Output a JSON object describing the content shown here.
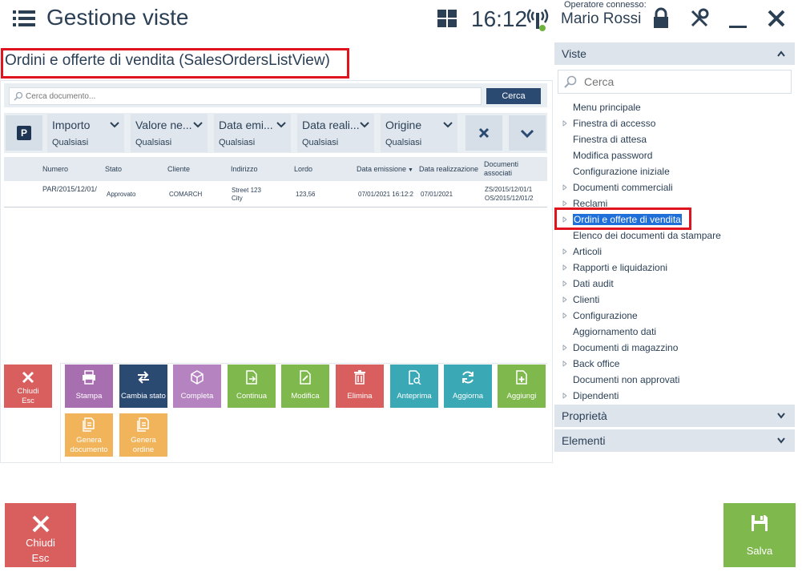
{
  "header": {
    "title": "Gestione viste",
    "clock": "16:12",
    "operator_label": "Operatore connesso:",
    "operator_name": "Mario Rossi"
  },
  "view": {
    "title": "Ordini e offerte di vendita (SalesOrdersListView)"
  },
  "search": {
    "placeholder": "Cerca documento...",
    "button_label": "Cerca"
  },
  "filters": [
    {
      "label": "Importo",
      "value": "Qualsiasi"
    },
    {
      "label": "Valore ne...",
      "value": "Qualsiasi"
    },
    {
      "label": "Data emi...",
      "value": "Qualsiasi"
    },
    {
      "label": "Data reali...",
      "value": "Qualsiasi"
    },
    {
      "label": "Origine",
      "value": "Qualsiasi"
    }
  ],
  "table": {
    "columns": [
      "Numero",
      "Stato",
      "Cliente",
      "Indirizzo",
      "Lordo",
      "Data emissione",
      "Data realizzazione",
      "Documenti associati"
    ],
    "rows": [
      {
        "numero": "PAR/2015/12/01/",
        "stato": "Approvato",
        "cliente": "COMARCH",
        "indirizzo_1": "Street 123",
        "indirizzo_2": "City",
        "lordo": "123,56",
        "data_emissione": "07/01/2021 16:12:2",
        "data_realizzazione": "07/01/2021",
        "doc_1": "ZS/2015/12/01/1",
        "doc_2": "OS/2015/12/01/2"
      }
    ]
  },
  "actions": {
    "close_small_1": "Chiudi",
    "close_small_2": "Esc",
    "tiles": [
      {
        "label": "Stampa",
        "color": "#a86fb0"
      },
      {
        "label": "Cambia stato",
        "color": "#2b4a72"
      },
      {
        "label": "Completa",
        "color": "#b584c0"
      },
      {
        "label": "Continua",
        "color": "#7fb84d"
      },
      {
        "label": "Modifica",
        "color": "#7fb84d"
      },
      {
        "label": "Elimina",
        "color": "#d95f5f"
      },
      {
        "label": "Anteprima",
        "color": "#3aa9b5"
      },
      {
        "label": "Aggiorna",
        "color": "#3aa9b5"
      },
      {
        "label": "Aggiungi",
        "color": "#7fb84d"
      }
    ],
    "tiles_row2": [
      {
        "label_1": "Genera",
        "label_2": "documento",
        "color": "#f2b45a"
      },
      {
        "label_1": "Genera",
        "label_2": "ordine",
        "color": "#f2b45a"
      }
    ]
  },
  "right_panel": {
    "viste_label": "Viste",
    "search_placeholder": "Cerca",
    "tree": [
      {
        "label": "Menu principale",
        "expandable": false
      },
      {
        "label": "Finestra di accesso",
        "expandable": true
      },
      {
        "label": "Finestra di attesa",
        "expandable": false
      },
      {
        "label": "Modifica password",
        "expandable": false
      },
      {
        "label": "Configurazione iniziale",
        "expandable": false
      },
      {
        "label": "Documenti commerciali",
        "expandable": true
      },
      {
        "label": "Reclami",
        "expandable": true
      },
      {
        "label": "Ordini e offerte di vendita",
        "expandable": true,
        "selected": true
      },
      {
        "label": "Elenco dei documenti da stampare",
        "expandable": false
      },
      {
        "label": "Articoli",
        "expandable": true
      },
      {
        "label": "Rapporti e liquidazioni",
        "expandable": true
      },
      {
        "label": "Dati audit",
        "expandable": true
      },
      {
        "label": "Clienti",
        "expandable": true
      },
      {
        "label": "Configurazione",
        "expandable": true
      },
      {
        "label": "Aggiornamento dati",
        "expandable": false
      },
      {
        "label": "Documenti di magazzino",
        "expandable": true
      },
      {
        "label": "Back office",
        "expandable": true
      },
      {
        "label": "Documenti non approvati",
        "expandable": false
      },
      {
        "label": "Dipendenti",
        "expandable": true
      }
    ],
    "proprieta_label": "Proprietà",
    "elementi_label": "Elementi"
  },
  "bottom": {
    "close_1": "Chiudi",
    "close_2": "Esc",
    "save": "Salva"
  },
  "colors": {
    "accent_navy": "#2b4a72",
    "text": "#2b3f55",
    "highlight": "#1e6fd9",
    "annotation_red": "#e0141e"
  }
}
